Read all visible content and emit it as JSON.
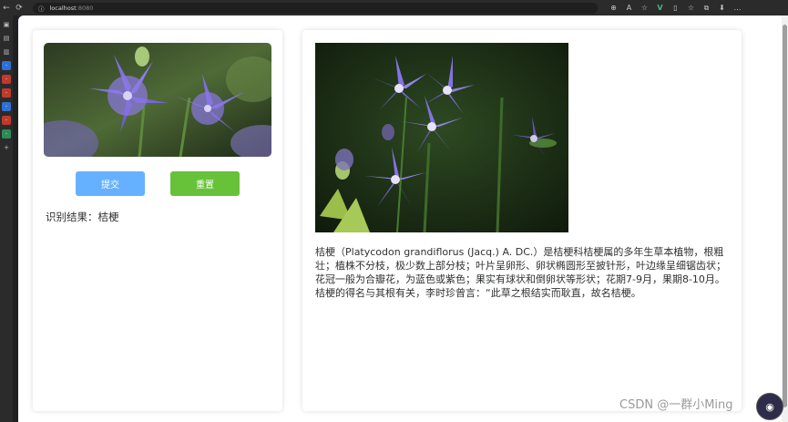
{
  "browser": {
    "url_host": "localhost",
    "url_port": ":8080",
    "nav_back": "←",
    "nav_reload": "⟳",
    "info_icon": "ⓘ",
    "toolbar_glyphs": [
      "⊕",
      "A",
      "☆",
      "V",
      "▯",
      "☆",
      "⧉",
      "⬇",
      "…"
    ]
  },
  "left_card": {
    "submit_label": "提交",
    "reset_label": "重置",
    "result_text": "识别结果：桔梗"
  },
  "right_card": {
    "description": "桔梗（Platycodon grandiflorus (Jacq.) A. DC.）是桔梗科桔梗属的多年生草本植物，根粗壮；植株不分枝，极少数上部分枝；叶片呈卵形、卵状椭圆形至披针形，叶边缘呈细锯齿状；花冠一般为合瓣花，为蓝色或紫色；果实有球状和倒卵状等形状；花期7-9月，果期8-10月。 桔梗的得名与其根有关，李时珍曾言：“此草之根结实而耿直，故名桔梗。"
  },
  "watermark": "CSDN @一群小Ming",
  "colors": {
    "submit": "#66b1ff",
    "reset": "#67c23a",
    "petal": "#7b6be0"
  }
}
